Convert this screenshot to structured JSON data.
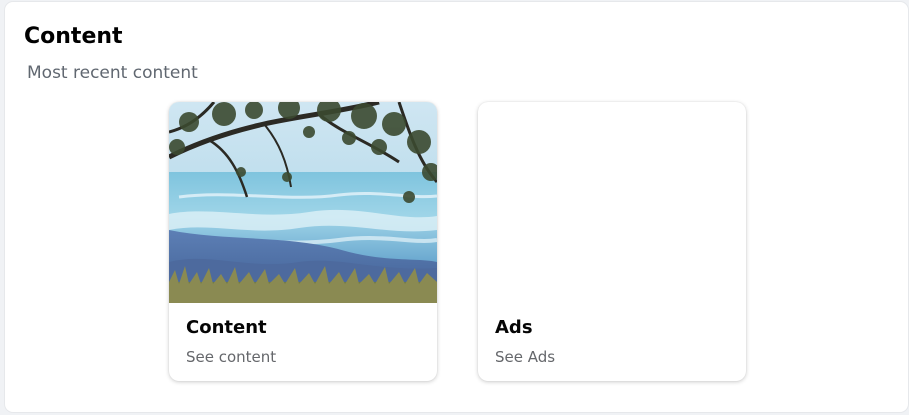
{
  "section": {
    "title": "Content",
    "subtitle": "Most recent content"
  },
  "cards": [
    {
      "title": "Content",
      "subtitle": "See content",
      "thumbnail": "lake-landscape-image"
    },
    {
      "title": "Ads",
      "subtitle": "See Ads",
      "thumbnail": "empty"
    }
  ],
  "colors": {
    "background": "#f0f2f5",
    "card": "#ffffff",
    "title_text": "#050505",
    "secondary_text": "#65676b"
  }
}
